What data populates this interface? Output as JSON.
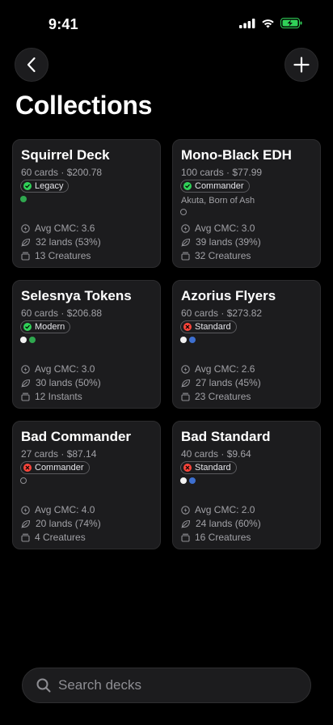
{
  "status_bar": {
    "time": "9:41",
    "icons": [
      "signal-icon",
      "wifi-icon",
      "battery-charging-icon"
    ],
    "battery_color": "#30d158"
  },
  "nav": {
    "back_icon": "chevron-left-icon",
    "add_icon": "plus-icon"
  },
  "page": {
    "title": "Collections"
  },
  "colors": {
    "legal": "#30d158",
    "not_legal": "#ff453a",
    "card_bg": "#1c1c1e"
  },
  "decks": [
    {
      "name": "Squirrel Deck",
      "cards": "60 cards",
      "price": "$200.78",
      "format": "Legacy",
      "legal": true,
      "commander": "",
      "colors": [
        "G"
      ],
      "stats": {
        "avg_cmc": "Avg CMC: 3.6",
        "lands": "32 lands (53%)",
        "type_count": "13 Creatures"
      }
    },
    {
      "name": "Mono-Black EDH",
      "cards": "100 cards",
      "price": "$77.99",
      "format": "Commander",
      "legal": true,
      "commander": "Akuta, Born of Ash",
      "colors": [
        "C"
      ],
      "stats": {
        "avg_cmc": "Avg CMC: 3.0",
        "lands": "39 lands (39%)",
        "type_count": "32 Creatures"
      }
    },
    {
      "name": "Selesnya Tokens",
      "cards": "60 cards",
      "price": "$206.88",
      "format": "Modern",
      "legal": true,
      "commander": "",
      "colors": [
        "W",
        "G"
      ],
      "stats": {
        "avg_cmc": "Avg CMC: 3.0",
        "lands": "30 lands (50%)",
        "type_count": "12 Instants"
      }
    },
    {
      "name": "Azorius Flyers",
      "cards": "60 cards",
      "price": "$273.82",
      "format": "Standard",
      "legal": false,
      "commander": "",
      "colors": [
        "W",
        "U"
      ],
      "stats": {
        "avg_cmc": "Avg CMC: 2.6",
        "lands": "27 lands (45%)",
        "type_count": "23 Creatures"
      }
    },
    {
      "name": "Bad Commander",
      "cards": "27 cards",
      "price": "$87.14",
      "format": "Commander",
      "legal": false,
      "commander": "",
      "colors": [
        "C"
      ],
      "stats": {
        "avg_cmc": "Avg CMC: 4.0",
        "lands": "20 lands (74%)",
        "type_count": "4 Creatures"
      }
    },
    {
      "name": "Bad Standard",
      "cards": "40 cards",
      "price": "$9.64",
      "format": "Standard",
      "legal": false,
      "commander": "",
      "colors": [
        "W",
        "U"
      ],
      "stats": {
        "avg_cmc": "Avg CMC: 2.0",
        "lands": "24 lands (60%)",
        "type_count": "16 Creatures"
      }
    }
  ],
  "search": {
    "placeholder": "Search decks",
    "value": ""
  }
}
